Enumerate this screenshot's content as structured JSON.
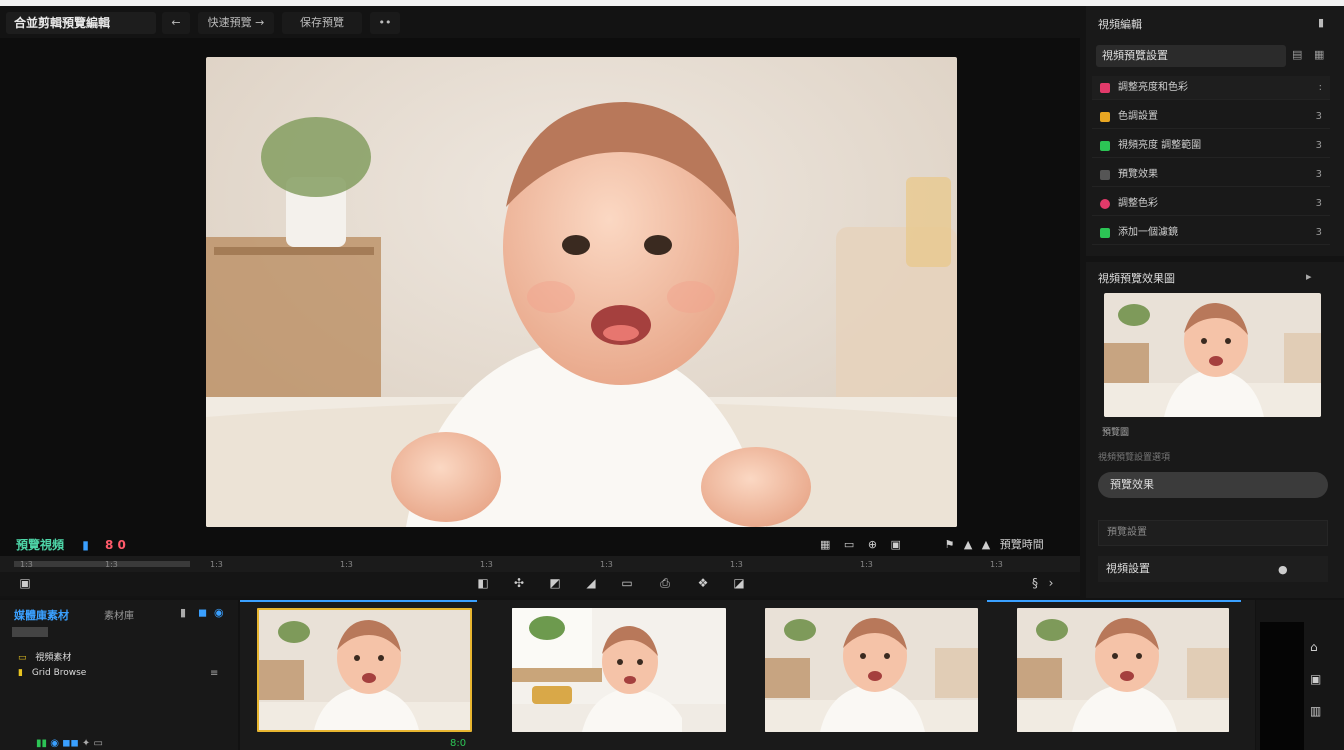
{
  "toolbar": {
    "title": "合並剪輯預覽編輯",
    "nav_label": "快速預覽 →",
    "save_label": "保存預覽",
    "more": "••"
  },
  "status": {
    "left_label": "預覽視頻",
    "left_value": "8 0",
    "right_label": "預覽時間"
  },
  "ruler": [
    "1:3",
    "1:3",
    "1:3",
    "1:3",
    "1:3",
    "1:3",
    "1:3",
    "1:3",
    "1:3"
  ],
  "right_panel": {
    "title": "視頻編輯",
    "input": "視頻預覽設置",
    "rows": [
      {
        "label": "調整亮度和色彩",
        "color": "#e23a6a",
        "end": ":"
      },
      {
        "label": "色調設置",
        "color": "#e8a622",
        "end": "3"
      },
      {
        "label": "視頻亮度 調整範圍",
        "color": "#2cc455",
        "end": "3"
      },
      {
        "label": "預覽效果",
        "color": "#555555",
        "end": "3"
      },
      {
        "label": "調整色彩",
        "color": "#e23a6a",
        "end": "3"
      },
      {
        "label": "添加一個濾鏡",
        "color": "#2cc455",
        "end": "3"
      }
    ]
  },
  "preview_panel": {
    "title": "視頻預覽效果圖",
    "subtitle": "預覽圖",
    "line": "視頻預覽設置選項",
    "button": "預覽效果",
    "field1": "預覽設置",
    "field2": "視頻設置"
  },
  "media": {
    "title": "媒體庫素材",
    "tab2": "素材庫",
    "items": [
      "視頻素材",
      "Grid Browse"
    ]
  },
  "timeline_time": "8:0"
}
